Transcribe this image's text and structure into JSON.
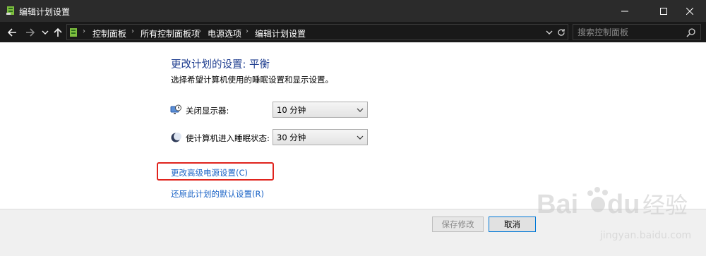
{
  "window": {
    "title": "编辑计划设置",
    "minimize": "—",
    "maximize": "☐",
    "close": "✕"
  },
  "nav": {
    "back": "←",
    "forward": "→",
    "recent": "⌄",
    "up": "↑",
    "breadcrumbs": [
      "控制面板",
      "所有控制面板项",
      "电源选项",
      "编辑计划设置"
    ],
    "separator": "›",
    "dropdown": "⌄",
    "refresh": "↻",
    "search_placeholder": "搜索控制面板"
  },
  "main": {
    "heading": "更改计划的设置: 平衡",
    "description": "选择希望计算机使用的睡眠设置和显示设置。",
    "settings": [
      {
        "label": "关闭显示器:",
        "value": "10 分钟",
        "icon": "monitor-clock-icon"
      },
      {
        "label": "使计算机进入睡眠状态:",
        "value": "30 分钟",
        "icon": "moon-sleep-icon"
      }
    ],
    "links": {
      "advanced": "更改高级电源设置(C)",
      "restore": "还原此计划的默认设置(R)"
    }
  },
  "footer": {
    "save": "保存修改",
    "cancel": "取消"
  },
  "watermark": {
    "brand": "Bai",
    "brand2": "du",
    "suffix": "经验",
    "url": "jingyan.baidu.com"
  },
  "colors": {
    "titlebar": "#2b2b2b",
    "navbar": "#191919",
    "heading": "#1e3d8f",
    "link": "#1a63c6",
    "highlight": "#e0231d"
  }
}
